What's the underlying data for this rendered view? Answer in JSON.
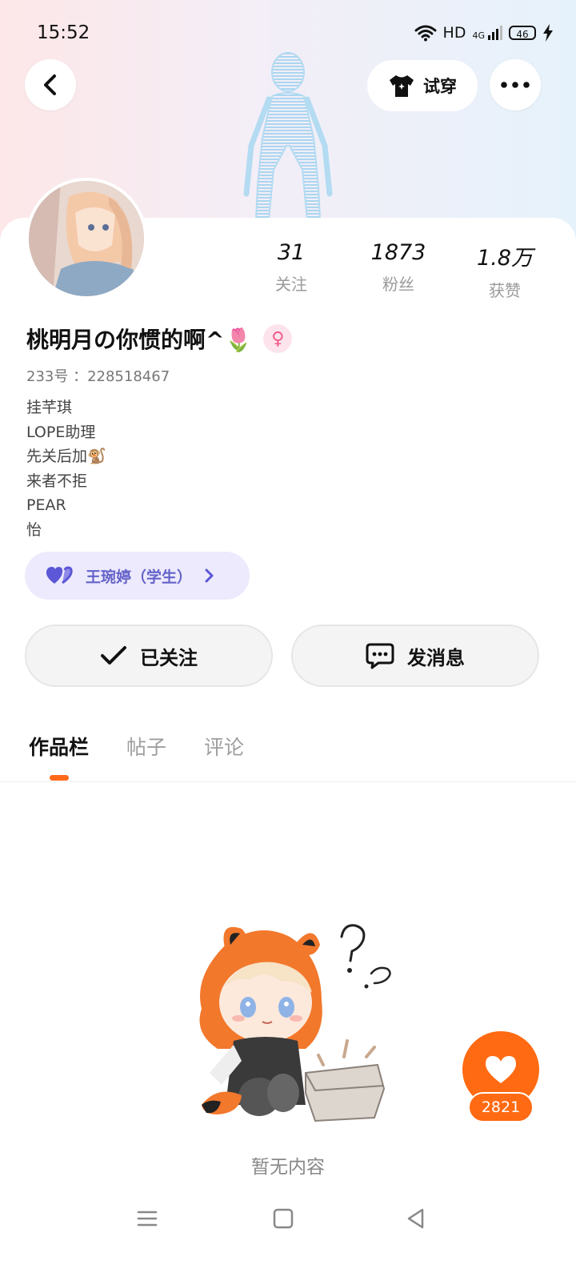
{
  "status_bar": {
    "time": "15:52",
    "network_label": "HD",
    "signal_label": "4G",
    "battery": "46",
    "icons": [
      "wifi-icon",
      "signal-icon",
      "battery-icon",
      "charging-icon"
    ]
  },
  "header": {
    "back_icon": "chevron-left-icon",
    "try_on_label": "试穿",
    "try_on_icon": "tshirt-icon",
    "more_icon": "more-dots-icon"
  },
  "profile": {
    "name": "桃明月の你惯的啊^🌷",
    "gender_symbol": "♀",
    "uid": "233号 ：228518467",
    "bio_lines": [
      "挂芊琪",
      "LOPE助理",
      "先关后加🐒",
      "来者不拒",
      "PEAR",
      "怡"
    ],
    "stats": [
      {
        "value": "31",
        "label": "关注"
      },
      {
        "value": "1873",
        "label": "粉丝"
      },
      {
        "value": "1.8万",
        "label": "获赞"
      }
    ],
    "relation_tag": "王琬婷（学生）",
    "relation_icon": "double-heart-icon"
  },
  "actions": {
    "followed_label": "已关注",
    "message_label": "发消息"
  },
  "tabs": [
    {
      "label": "作品栏",
      "active": true
    },
    {
      "label": "帖子",
      "active": false
    },
    {
      "label": "评论",
      "active": false
    }
  ],
  "empty_state": {
    "text": "暂无内容"
  },
  "like_widget": {
    "count": "2821"
  },
  "colors": {
    "accent_orange": "#ff6a12",
    "tag_purple": "#6563c9",
    "tag_bg": "#eceafc"
  }
}
